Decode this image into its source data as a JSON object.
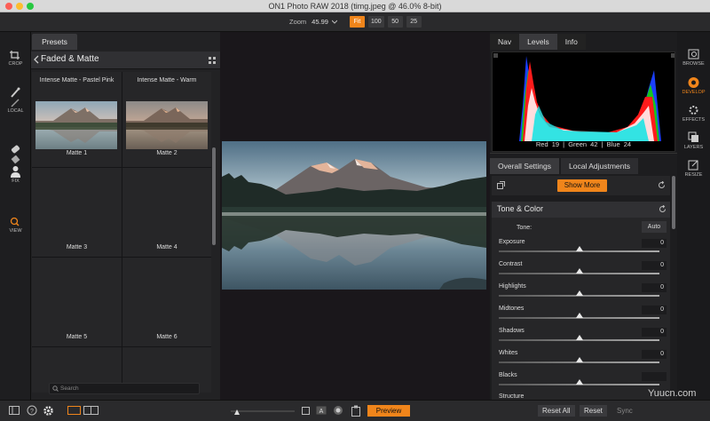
{
  "window": {
    "title": "ON1 Photo RAW 2018 (timg.jpeg @ 46.0% 8-bit)"
  },
  "toolbar": {
    "zoom_label": "Zoom",
    "zoom_value": "45.99",
    "zoom_buttons": [
      "Fit",
      "100",
      "50",
      "25"
    ],
    "active_zoom": "Fit"
  },
  "left_tools": [
    "CROP",
    "LOCAL",
    "FIX",
    "VIEW"
  ],
  "presets": {
    "tab_label": "Presets",
    "category": "Faded & Matte",
    "items": [
      {
        "top_label": "Intense Matte - Pastel Pink",
        "name": "Matte 1"
      },
      {
        "top_label": "Intense Matte - Warm",
        "name": "Matte 2"
      },
      {
        "top_label": "",
        "name": "Matte 3"
      },
      {
        "top_label": "",
        "name": "Matte 4"
      },
      {
        "top_label": "",
        "name": "Matte 5"
      },
      {
        "top_label": "",
        "name": "Matte 6"
      }
    ],
    "search_placeholder": "Search"
  },
  "right_panel": {
    "tabs": [
      "Nav",
      "Levels",
      "Info"
    ],
    "active_tab": "Levels",
    "rgb": {
      "red_label": "Red",
      "red": "19",
      "green_label": "Green",
      "green": "42",
      "blue_label": "Blue",
      "blue": "24"
    },
    "adjust_tabs": [
      "Overall Settings",
      "Local Adjustments"
    ],
    "active_adjust_tab": "Overall Settings",
    "show_more": "Show More",
    "section_title": "Tone & Color",
    "tone_label": "Tone:",
    "auto_label": "Auto",
    "sliders": [
      {
        "name": "Exposure",
        "value": "0"
      },
      {
        "name": "Contrast",
        "value": "0"
      },
      {
        "name": "Highlights",
        "value": "0"
      },
      {
        "name": "Midtones",
        "value": "0"
      },
      {
        "name": "Shadows",
        "value": "0"
      },
      {
        "name": "Whites",
        "value": "0"
      },
      {
        "name": "Blacks",
        "value": ""
      },
      {
        "name": "Structure",
        "value": ""
      }
    ]
  },
  "modules": [
    "BROWSE",
    "DEVELOP",
    "EFFECTS",
    "LAYERS",
    "RESIZE"
  ],
  "active_module": "DEVELOP",
  "bottom": {
    "preview": "Preview",
    "reset_all": "Reset All",
    "reset": "Reset",
    "sync": "Sync"
  },
  "watermark": "Yuucn.com",
  "colors": {
    "accent": "#f0851b",
    "panel": "#262628",
    "background": "#1b1b1d"
  }
}
